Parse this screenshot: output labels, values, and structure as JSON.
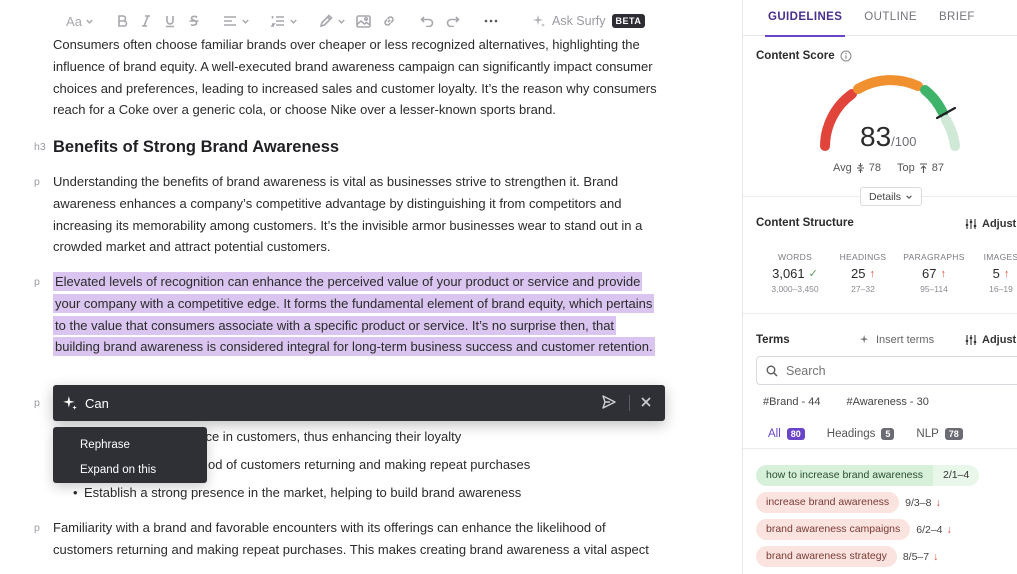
{
  "toolbar": {
    "font_size_label": "Aa",
    "ask_label": "Ask Surfy",
    "beta_label": "BETA"
  },
  "editor": {
    "para1": "Consumers often choose familiar brands over cheaper or less recognized alternatives, highlighting the influence of brand equity. A well-executed brand awareness campaign can significantly impact consumer choices and preferences, leading to increased sales and customer loyalty. It’s the reason why consumers reach for a Coke over a generic cola, or choose Nike over a lesser-known sports brand.",
    "h3_tag": "h3",
    "heading": "Benefits of Strong Brand Awareness",
    "p_tag": "p",
    "para2": "Understanding the benefits of brand awareness is vital as businesses strive to strengthen it. Brand awareness enhances a company’s competitive advantage by distinguishing it from competitors and increasing its memorability among customers. It’s the invisible armor businesses wear to stand out in a crowded market and attract potential customers.",
    "para3_selected": "Elevated levels of recognition can enhance the perceived value of your product or service and provide your company with a competitive edge. It forms the fundamental element of brand equity, which pertains to the value that consumers associate with a specific product or service. It’s no surprise then, that building brand awareness is considered integral for long-term business success and customer retention.",
    "bullets": [
      "ance in customers, thus enhancing their loyalty",
      "od of customers returning and making repeat purchases",
      "Establish a strong presence in the market, helping to build brand awareness"
    ],
    "para4": "Familiarity with a brand and favorable encounters with its offerings can enhance the likelihood of customers returning and making repeat purchases. This makes creating brand awareness a vital aspect"
  },
  "ai_prompt": {
    "value": "Can",
    "options": [
      "Rephrase",
      "Expand on this"
    ]
  },
  "sidebar": {
    "tabs": [
      "GUIDELINES",
      "OUTLINE",
      "BRIEF"
    ],
    "content_score": {
      "title": "Content Score",
      "score": "83",
      "max": "/100",
      "avg_label": "Avg",
      "avg_value": "78",
      "top_label": "Top",
      "top_value": "87",
      "details_label": "Details"
    },
    "structure": {
      "title": "Content Structure",
      "adjust_label": "Adjust",
      "metrics": [
        {
          "label": "WORDS",
          "value": "3,061",
          "range": "3,000–3,450",
          "status": "ok"
        },
        {
          "label": "HEADINGS",
          "value": "25",
          "range": "27–32",
          "status": "up"
        },
        {
          "label": "PARAGRAPHS",
          "value": "67",
          "range": "95–114",
          "status": "up"
        },
        {
          "label": "IMAGES",
          "value": "5",
          "range": "16–19",
          "status": "up"
        }
      ]
    },
    "terms": {
      "title": "Terms",
      "insert_label": "Insert terms",
      "adjust_label": "Adjust",
      "search_placeholder": "Search",
      "chips": [
        "#Brand - 44",
        "#Awareness - 30"
      ],
      "filters": [
        {
          "label": "All",
          "count": "80"
        },
        {
          "label": "Headings",
          "count": "5"
        },
        {
          "label": "NLP",
          "count": "78"
        }
      ],
      "items": [
        {
          "name": "how to increase brand awareness",
          "count": "2/1–4",
          "state": "good"
        },
        {
          "name": "increase brand awareness",
          "count": "9/3–8",
          "state": "bad"
        },
        {
          "name": "brand awareness campaigns",
          "count": "6/2–4",
          "state": "bad"
        },
        {
          "name": "brand awareness strategy",
          "count": "8/5–7",
          "state": "bad"
        }
      ]
    }
  },
  "colors": {
    "accent": "#6b45c8",
    "highlight": "#d9c5f0",
    "gauge_red": "#e0443a",
    "gauge_orange": "#f0902e",
    "gauge_green": "#3fb36a"
  }
}
